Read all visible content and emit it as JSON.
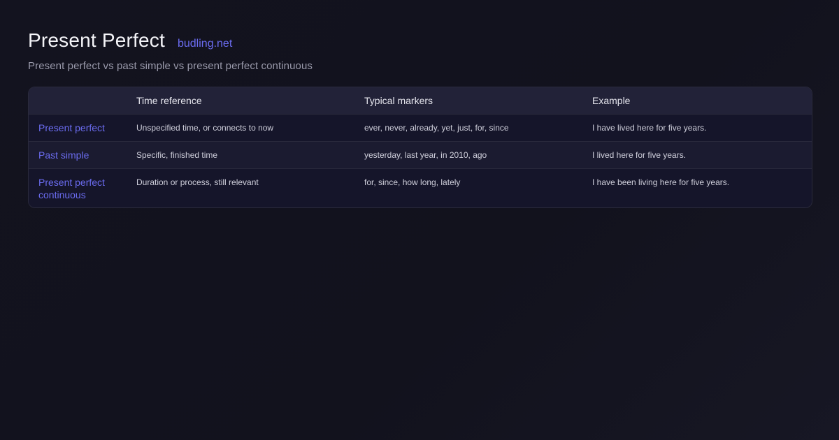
{
  "header": {
    "title": "Present Perfect",
    "site": "budling.net",
    "subtitle": "Present perfect vs past simple vs present perfect continuous"
  },
  "table": {
    "columns": [
      "",
      "Time reference",
      "Typical markers",
      "Example"
    ],
    "rows": [
      {
        "term": "Present perfect",
        "time_reference": "Unspecified time, or connects to now",
        "markers": "ever, never, already, yet, just, for, since",
        "example": "I have lived here for five years."
      },
      {
        "term": "Past simple",
        "time_reference": "Specific, finished time",
        "markers": "yesterday, last year, in 2010, ago",
        "example": "I lived here for five years."
      },
      {
        "term": "Present perfect continuous",
        "time_reference": "Duration or process, still relevant",
        "markers": "for, since, how long, lately",
        "example": "I have been living here for five years."
      }
    ]
  },
  "colors": {
    "accent": "#6b6cf0",
    "background": "#13131f",
    "header_row": "#222238"
  }
}
